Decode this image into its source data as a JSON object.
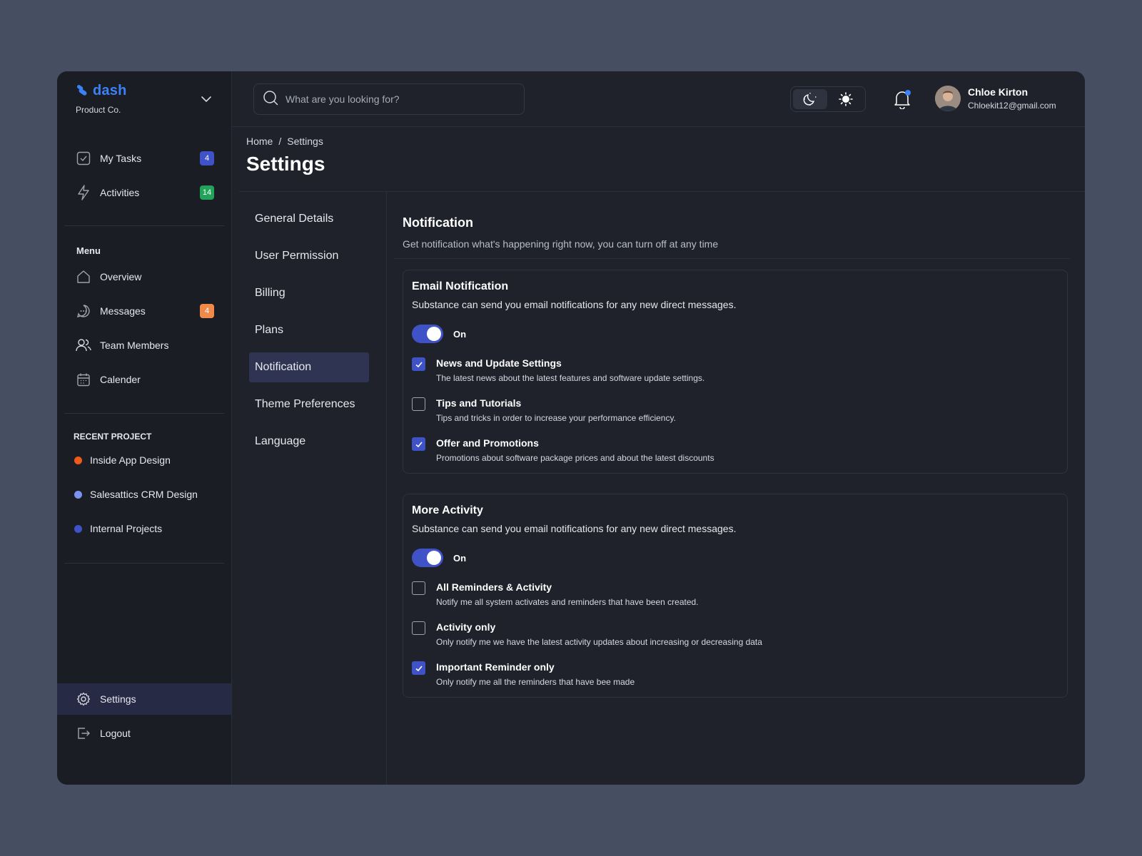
{
  "brand": {
    "name": "dash",
    "subtitle": "Product Co."
  },
  "sidebar": {
    "top_items": [
      {
        "label": "My Tasks",
        "badge": "4",
        "badge_color": "#3f52c8"
      },
      {
        "label": "Activities",
        "badge": "14",
        "badge_color": "#22a35a"
      }
    ],
    "menu_title": "Menu",
    "menu_items": [
      {
        "label": "Overview"
      },
      {
        "label": "Messages",
        "badge": "4",
        "badge_color": "#f08a4b"
      },
      {
        "label": "Team Members"
      },
      {
        "label": "Calender"
      }
    ],
    "recent_title": "RECENT PROJECT",
    "projects": [
      {
        "label": "Inside App Design",
        "color": "#f05a1a"
      },
      {
        "label": "Salesattics CRM Design",
        "color": "#7b93f0"
      },
      {
        "label": "Internal Projects",
        "color": "#3f52c8"
      }
    ],
    "settings_label": "Settings",
    "logout_label": "Logout"
  },
  "search": {
    "placeholder": "What are you looking for?"
  },
  "user": {
    "name": "Chloe Kirton",
    "email": "Chloekit12@gmail.com"
  },
  "breadcrumb": {
    "home": "Home",
    "separator": "/",
    "current": "Settings"
  },
  "page_title": "Settings",
  "settings_nav": [
    {
      "label": "General Details"
    },
    {
      "label": "User Permission"
    },
    {
      "label": "Billing"
    },
    {
      "label": "Plans"
    },
    {
      "label": "Notification",
      "active": true
    },
    {
      "label": "Theme Preferences"
    },
    {
      "label": "Language"
    }
  ],
  "notification": {
    "title": "Notification",
    "description": "Get notification what's happening right now, you can turn off at any time",
    "email_card": {
      "title": "Email Notification",
      "description": "Substance can send you email notifications for any new direct messages.",
      "toggle_label": "On",
      "options": [
        {
          "title": "News and Update Settings",
          "description": "The latest news about the latest features and software update settings.",
          "checked": true
        },
        {
          "title": "Tips and Tutorials",
          "description": "Tips and tricks in order to increase your performance efficiency.",
          "checked": false
        },
        {
          "title": "Offer and Promotions",
          "description": "Promotions about software package prices and about the latest discounts",
          "checked": true
        }
      ]
    },
    "activity_card": {
      "title": "More Activity",
      "description": "Substance can send you email notifications for any new direct messages.",
      "toggle_label": "On",
      "options": [
        {
          "title": "All Reminders & Activity",
          "description": "Notify me all system activates and reminders that have been created.",
          "checked": false
        },
        {
          "title": "Activity only",
          "description": "Only notify me we have the latest activity updates about increasing or decreasing data",
          "checked": false
        },
        {
          "title": "Important Reminder only",
          "description": "Only notify me all the reminders that have bee  made",
          "checked": true
        }
      ]
    }
  },
  "colors": {
    "accent": "#3f52c8",
    "brand": "#3b82f6",
    "active_nav": "#2f3452"
  }
}
